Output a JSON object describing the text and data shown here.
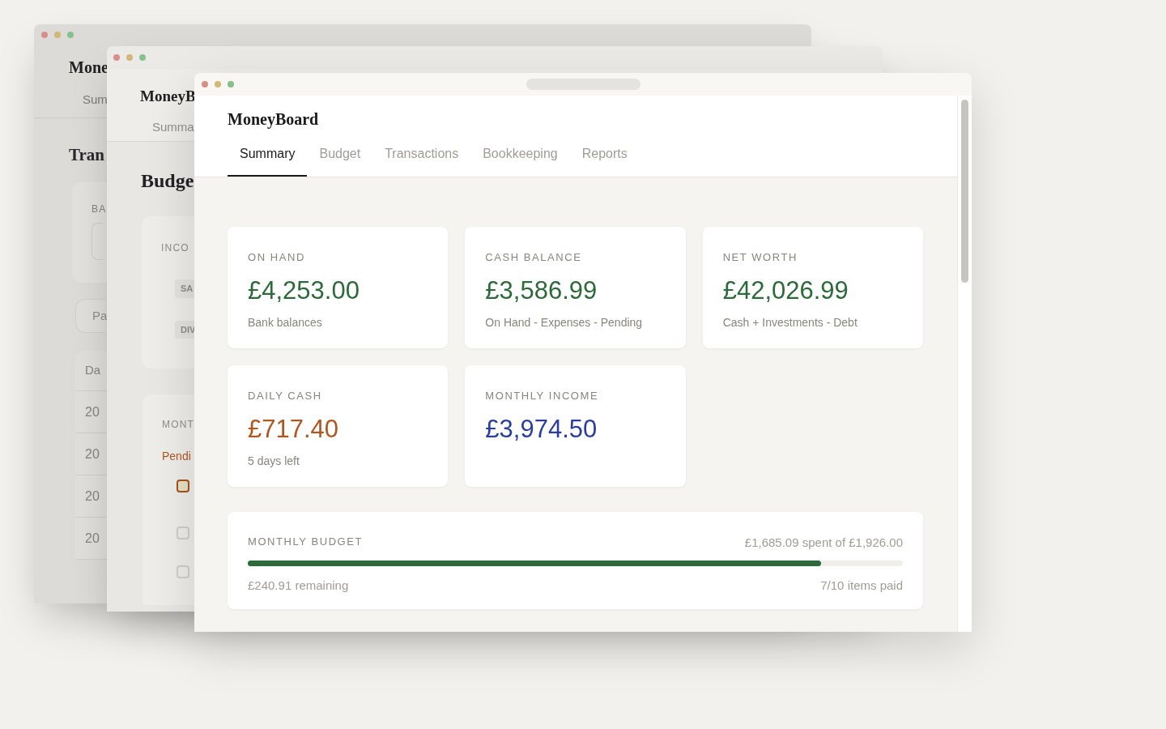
{
  "back_window": {
    "logo": "Mone",
    "tab": "Sum",
    "heading": "Tran",
    "filter_label": "BA",
    "page_total": "Pa",
    "column": "Da",
    "dates": [
      "20",
      "20",
      "20",
      "20"
    ]
  },
  "middle_window": {
    "logo": "MoneyB",
    "tab": "Summa",
    "heading": "Budge",
    "income_label": "INCO",
    "chips": [
      "SA",
      "DIV"
    ],
    "monthly_label": "MONT",
    "pending": "Pendi",
    "checkboxes": [
      {
        "active": true
      },
      {
        "active": false
      },
      {
        "active": false
      }
    ]
  },
  "front_window": {
    "logo": "MoneyBoard",
    "tabs": [
      {
        "label": "Summary",
        "selected": true
      },
      {
        "label": "Budget",
        "selected": false
      },
      {
        "label": "Transactions",
        "selected": false
      },
      {
        "label": "Bookkeeping",
        "selected": false
      },
      {
        "label": "Reports",
        "selected": false
      }
    ],
    "cards": [
      {
        "label": "ON HAND",
        "value": "£4,253.00",
        "note": "Bank balances",
        "color": "#2d6a3a"
      },
      {
        "label": "CASH BALANCE",
        "value": "£3,586.99",
        "note": "On Hand - Expenses - Pending",
        "color": "#2d6a3a"
      },
      {
        "label": "NET WORTH",
        "value": "£42,026.99",
        "note": "Cash + Investments - Debt",
        "color": "#2d6a3a"
      },
      {
        "label": "DAILY CASH",
        "value": "£717.40",
        "note": "5 days left",
        "color": "#b0561f"
      },
      {
        "label": "MONTHLY INCOME",
        "value": "£3,974.50",
        "color": "#2a3ea0"
      }
    ],
    "budget": {
      "label": "MONTHLY BUDGET",
      "summary": "£1,685.09 spent of £1,926.00",
      "level": 0.875,
      "remaining": "£240.91 remaining",
      "items_paid": "7/10 items paid"
    }
  }
}
